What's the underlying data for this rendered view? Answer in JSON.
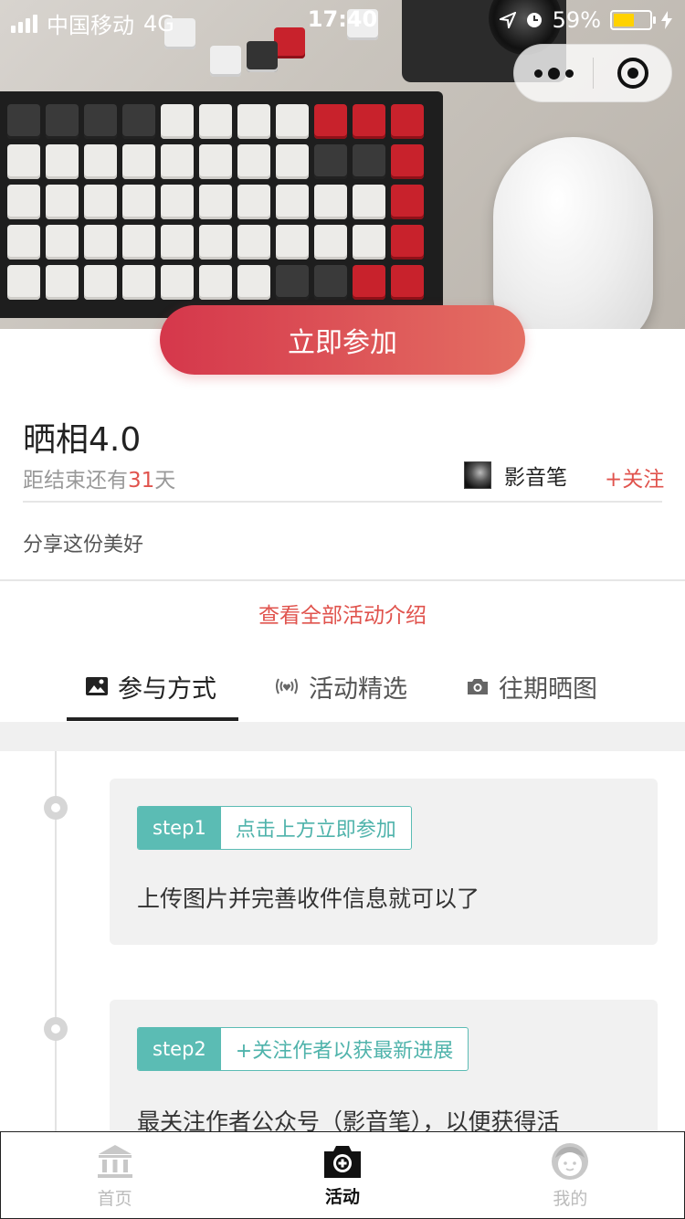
{
  "status_bar": {
    "carrier": "中国移动",
    "network": "4G",
    "time": "17:40",
    "battery": "59%"
  },
  "capsule": {
    "more_icon": "more-dots-icon",
    "close_icon": "target-close-icon"
  },
  "join_button": "立即参加",
  "activity": {
    "title": "晒相4.0",
    "countdown_prefix": "距结束还有",
    "countdown_days": "31",
    "countdown_suffix": "天",
    "author_name": "影音笔",
    "follow": "+关注",
    "description": "分享这份美好",
    "view_all": "查看全部活动介绍"
  },
  "tabs": [
    {
      "label": "参与方式",
      "icon": "image-icon",
      "active": true
    },
    {
      "label": "活动精选",
      "icon": "broadcast-heart-icon",
      "active": false
    },
    {
      "label": "往期晒图",
      "icon": "camera-icon",
      "active": false
    }
  ],
  "steps": [
    {
      "num": "step1",
      "tag": "点击上方立即参加",
      "text": "上传图片并完善收件信息就可以了"
    },
    {
      "num": "step2",
      "tag": "+关注作者以获最新进展",
      "text": "最关注作者公众号（影音笔），以便获得活"
    }
  ],
  "bottom_nav": [
    {
      "label": "首页",
      "icon": "bank-home-icon",
      "active": false
    },
    {
      "label": "活动",
      "icon": "camera-activity-icon",
      "active": true
    },
    {
      "label": "我的",
      "icon": "user-face-icon",
      "active": false
    }
  ],
  "colors": {
    "accent_red": "#e0534d",
    "teal": "#5bbcb4"
  }
}
